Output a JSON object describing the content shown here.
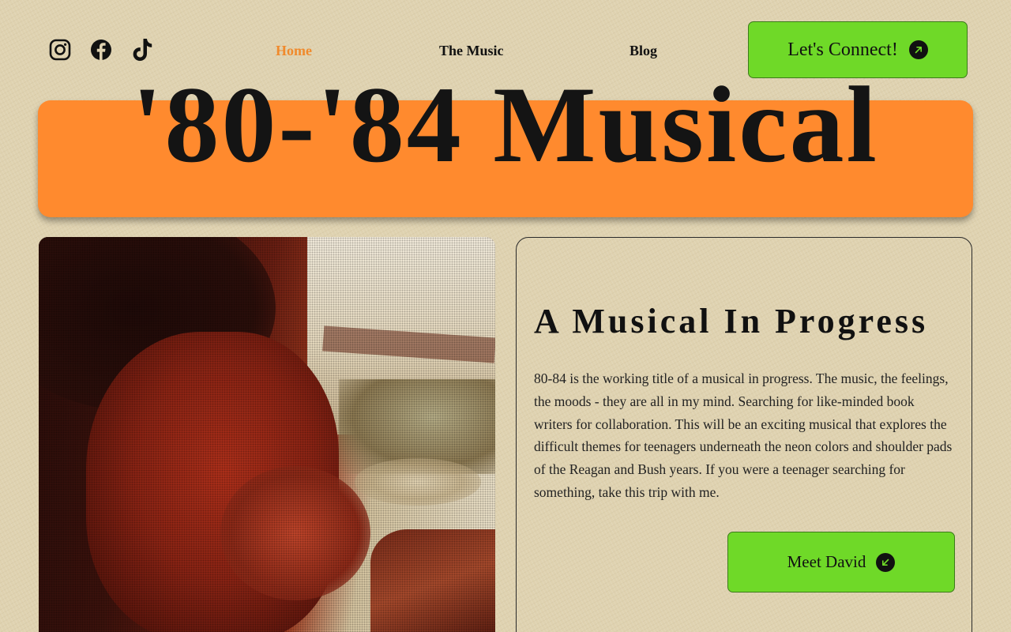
{
  "header": {
    "social": [
      {
        "icon": "instagram-icon"
      },
      {
        "icon": "facebook-icon"
      },
      {
        "icon": "tiktok-icon"
      }
    ],
    "nav": {
      "home": "Home",
      "music": "The Music",
      "blog": "Blog"
    },
    "cta_label": "Let's Connect!"
  },
  "hero": {
    "title": "'80-'84 Musical"
  },
  "about": {
    "title": "A Musical In Progress",
    "body": "80-84 is the working title of a musical in progress. The music, the feelings, the moods - they are all in my mind. Searching for like-minded book writers for collaboration. This will be an exciting musical that explores the difficult themes for teenagers underneath the neon colors and shoulder pads of the Reagan and Bush years. If you were a teenager searching for something, take this trip with me.",
    "button_label": "Meet David"
  },
  "colors": {
    "background": "#dfd2b0",
    "accent_orange": "#ff8a2e",
    "active_nav": "#f08a2c",
    "button_green": "#6fd928",
    "text": "#111111"
  }
}
